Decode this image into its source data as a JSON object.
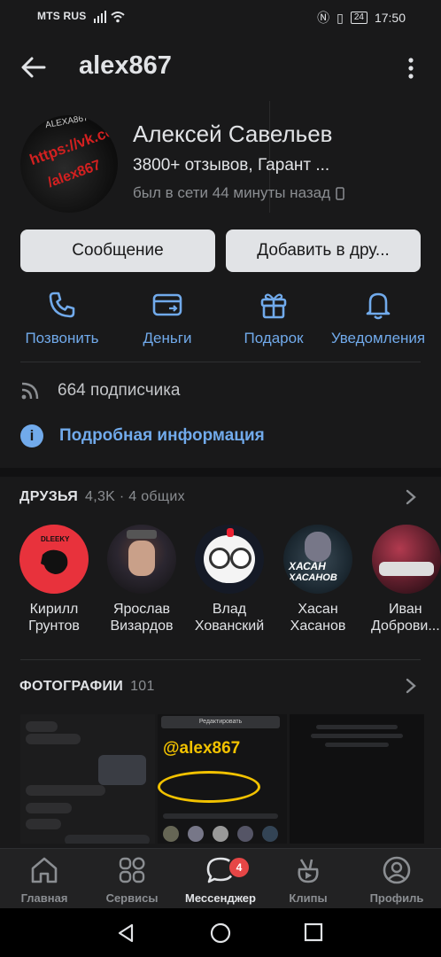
{
  "statusbar": {
    "carrier": "MTS RUS",
    "battery": "24",
    "time": "17:50"
  },
  "header": {
    "handle": "alex867"
  },
  "profile": {
    "avatar_text_top": "ALEXA867",
    "avatar_text_1": "https://vk.com",
    "avatar_text_2": "/alex867",
    "name": "Алексей Савельев",
    "status": "3800+ отзывов, Гарант ...",
    "online": "был в сети 44 минуты назад"
  },
  "buttons": {
    "message": "Сообщение",
    "add_friend": "Добавить в дру..."
  },
  "actions": [
    {
      "label": "Позвонить",
      "icon": "phone-icon"
    },
    {
      "label": "Деньги",
      "icon": "money-card-icon"
    },
    {
      "label": "Подарок",
      "icon": "gift-icon"
    },
    {
      "label": "Уведомления",
      "icon": "bell-icon"
    }
  ],
  "followers": "664 подписчика",
  "details_link": "Подробная информация",
  "friends": {
    "title": "ДРУЗЬЯ",
    "meta": "4,3K · 4 общих",
    "items": [
      {
        "first": "Кирилл",
        "last": "Грунтов",
        "color": "#e8323c"
      },
      {
        "first": "Ярослав",
        "last": "Визардов",
        "color": "#2b2630"
      },
      {
        "first": "Влад",
        "last": "Хованский",
        "color": "#f0f0f0"
      },
      {
        "first": "Хасан",
        "last": "Хасанов",
        "color": "#1d2a33"
      },
      {
        "first": "Иван",
        "last": "Доброви...",
        "color": "#5a1d2a"
      }
    ],
    "avatar_text_1": "DLEEKY",
    "avatar_text_4a": "ХАСАН",
    "avatar_text_4b": "ХАСАНОВ"
  },
  "photos": {
    "title": "ФОТОГРАФИИ",
    "count": "101",
    "overlay_handle": "@alex867",
    "ph2_top": "Редактировать"
  },
  "tabs": [
    {
      "label": "Главная",
      "icon": "home-icon"
    },
    {
      "label": "Сервисы",
      "icon": "services-grid-icon"
    },
    {
      "label": "Мессенджер",
      "icon": "messenger-icon",
      "badge": "4"
    },
    {
      "label": "Клипы",
      "icon": "clips-icon"
    },
    {
      "label": "Профиль",
      "icon": "profile-icon"
    }
  ],
  "colors": {
    "accent": "#71aaeb",
    "background": "#19191a",
    "badge": "#e64646",
    "highlight": "#f2c200"
  }
}
